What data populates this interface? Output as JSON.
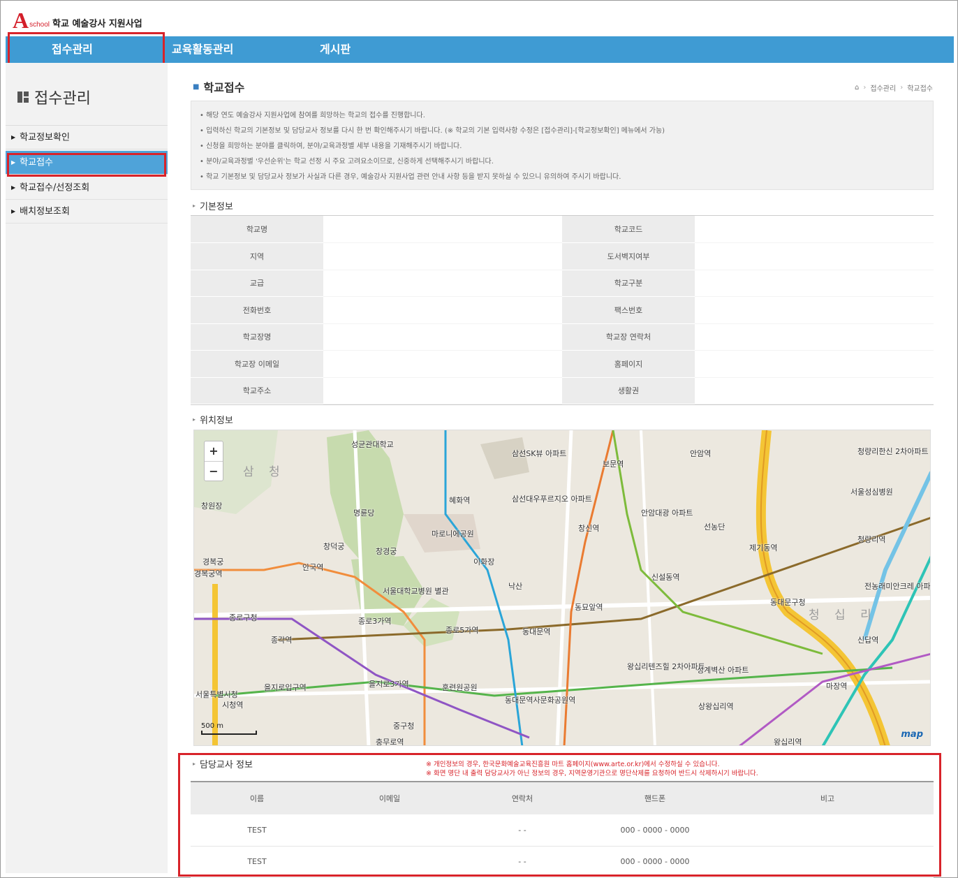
{
  "header": {
    "logo_letter": "A",
    "logo_sub": "school",
    "logo_title": "학교 예술강사 지원사업"
  },
  "topnav": [
    "접수관리",
    "교육활동관리",
    "게시판"
  ],
  "sidebar": {
    "title": "접수관리",
    "items": [
      "학교정보확인",
      "학교접수",
      "학교접수/선정조회",
      "배치정보조회"
    ]
  },
  "page": {
    "title": "학교접수",
    "breadcrumb": [
      "접수관리",
      "학교접수"
    ]
  },
  "notice": [
    "해당 연도 예술강사 지원사업에 참여를 희망하는 학교의 접수를 진행합니다.",
    "입력하신 학교의 기본정보 및 담당교사 정보를 다시 한 번 확인해주시기 바랍니다. (※ 학교의 기본 입력사항 수정은 [접수관리]-[학교정보확인] 메뉴에서 가능)",
    "신청을 희망하는 분야를 클릭하여, 분야/교육과정별 세부 내용을 기재해주시기 바랍니다.",
    "분야/교육과정별 '우선순위'는 학교 선정 시 주요 고려요소이므로, 신중하게 선택해주시기 바랍니다.",
    "학교 기본정보 및 담당교사 정보가 사실과 다른 경우, 예술강사 지원사업 관련 안내 사항 등을 받지 못하실 수 있으니 유의하여 주시기 바랍니다."
  ],
  "basic_info": {
    "heading": "기본정보",
    "rows": [
      [
        "학교명",
        "",
        "학교코드",
        ""
      ],
      [
        "지역",
        "",
        "도서벽지여부",
        ""
      ],
      [
        "교급",
        "",
        "학교구분",
        ""
      ],
      [
        "전화번호",
        "",
        "팩스번호",
        ""
      ],
      [
        "학교장명",
        "",
        "학교장 연락처",
        ""
      ],
      [
        "학교장 이메일",
        "",
        "홈페이지",
        ""
      ],
      [
        "학교주소",
        "",
        "생활권",
        ""
      ]
    ]
  },
  "location": {
    "heading": "위치정보",
    "zoom_in": "+",
    "zoom_out": "−",
    "scale": "500 m",
    "map_brand": "map",
    "labels": [
      "성균관대학교",
      "삼선SK뷰 아파트",
      "보문역",
      "안암역",
      "청량리한신 2차아파트",
      "창원장",
      "명륜당",
      "혜화역",
      "삼선대우푸르지오 아파트",
      "안암대광 아파트",
      "선농단",
      "서울성심병원",
      "청량리역",
      "마로니에공원",
      "창신역",
      "창덕궁",
      "창경궁",
      "이화장",
      "제기동역",
      "경복궁",
      "경복궁역",
      "안국역",
      "서울대학교병원 별관",
      "신설동역",
      "전농래미안크레 아파트",
      "낙산",
      "동묘앞역",
      "동대문구청",
      "종로구청",
      "종로3가역",
      "종로5가역",
      "동대문역",
      "종각역",
      "신답역",
      "왕십리텐즈힐 2차아파트",
      "성계벽산 아파트",
      "을지로입구역",
      "을지로3가역",
      "훈련원공원",
      "동대문역사문화공원역",
      "마장역",
      "서울특별시청",
      "시청역",
      "상왕십리역",
      "중구청",
      "충무로역",
      "왕십리역"
    ]
  },
  "teacher": {
    "heading": "담당교사 정보",
    "notes": [
      "※ 개인정보의 경우, 한국문화예술교육진흥원 마트 홈페이지(www.arte.or.kr)에서 수정하실 수 있습니다.",
      "※ 화면 명단 내 출력 담당교사가 아닌 정보의 경우, 지역운영기관으로 명단삭제를 요청하여 반드시 삭제하시기 바랍니다."
    ],
    "columns": [
      "이름",
      "이메일",
      "연락처",
      "핸드폰",
      "비고"
    ],
    "rows": [
      [
        "TEST",
        "",
        "- -",
        "000 - 0000 - 0000",
        ""
      ],
      [
        "TEST",
        "",
        "- -",
        "000 - 0000 - 0000",
        ""
      ]
    ]
  },
  "colors": {
    "nav": "#3f9bd3",
    "highlight": "#d8232a",
    "brand": "#d41f2a"
  }
}
